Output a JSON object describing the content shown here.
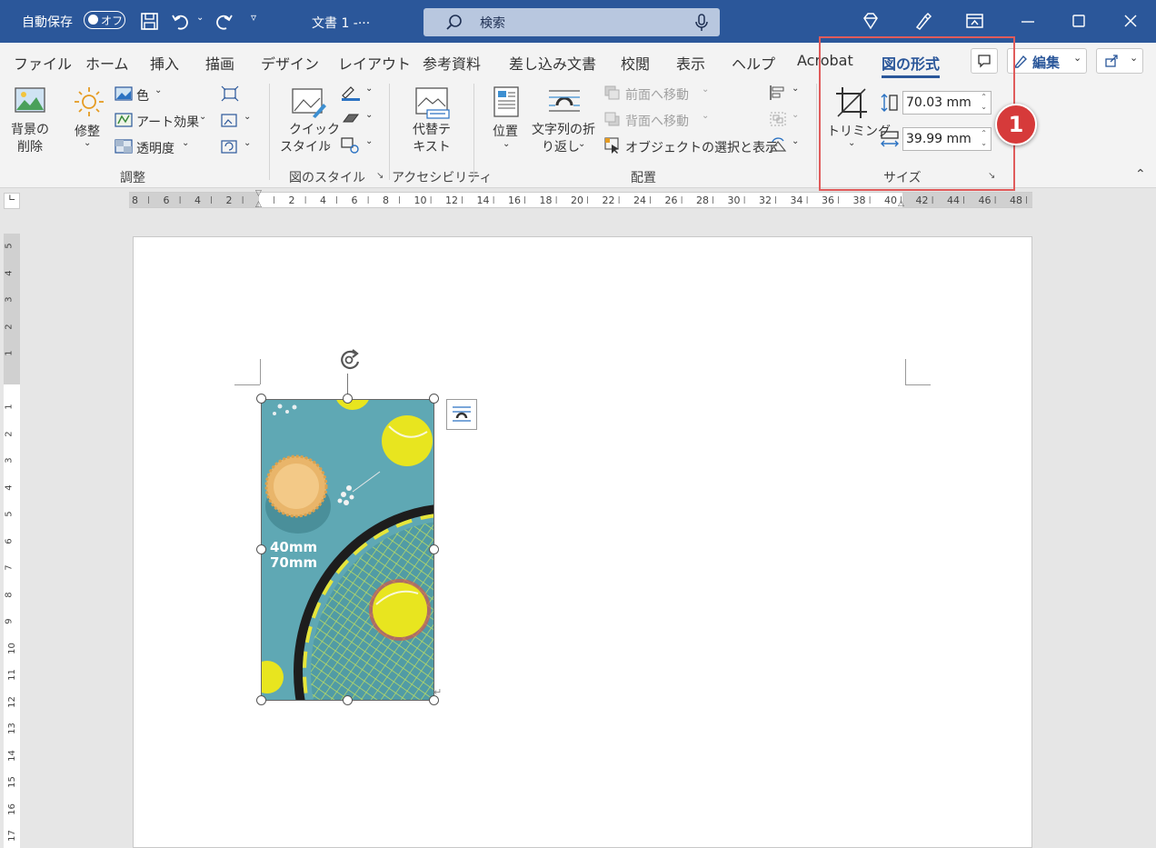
{
  "titlebar": {
    "autosave_label": "自動保存",
    "autosave_state": "オフ",
    "doc_title": "文書 1  -···",
    "search_placeholder": "検索"
  },
  "tabs": [
    {
      "label": "ファイル"
    },
    {
      "label": "ホーム"
    },
    {
      "label": "挿入"
    },
    {
      "label": "描画"
    },
    {
      "label": "デザイン"
    },
    {
      "label": "レイアウト"
    },
    {
      "label": "参考資料"
    },
    {
      "label": "差し込み文書"
    },
    {
      "label": "校閲"
    },
    {
      "label": "表示"
    },
    {
      "label": "ヘルプ"
    },
    {
      "label": "Acrobat"
    },
    {
      "label": "図の形式",
      "active": true
    }
  ],
  "edit_button": "編集",
  "ribbon": {
    "adjust": {
      "remove_bg": [
        "背景の",
        "削除"
      ],
      "corrections": "修整",
      "color": "色",
      "art_effects": "アート効果",
      "transparency": "透明度",
      "group_label": "調整"
    },
    "styles": {
      "quick_styles": [
        "クイック",
        "スタイル"
      ],
      "group_label": "図のスタイル"
    },
    "accessibility": {
      "alt_text": [
        "代替テ",
        "キスト"
      ],
      "group_label": "アクセシビリティ"
    },
    "arrange": {
      "position": "位置",
      "wrap_text": [
        "文字列の折",
        "り返し"
      ],
      "bring_forward": "前面へ移動",
      "send_backward": "背面へ移動",
      "selection_pane": "オブジェクトの選択と表示",
      "group_label": "配置"
    },
    "size": {
      "crop": "トリミング",
      "height": "70.03 mm",
      "width": "39.99 mm",
      "group_label": "サイズ"
    }
  },
  "callout_number": "1",
  "ruler": {
    "horizontal": [
      "8",
      "6",
      "4",
      "2",
      "",
      "2",
      "4",
      "6",
      "8",
      "10",
      "12",
      "14",
      "16",
      "18",
      "20",
      "22",
      "24",
      "26",
      "28",
      "30",
      "32",
      "34",
      "36",
      "38",
      "40",
      "42",
      "44",
      "46",
      "48"
    ],
    "vertical": [
      "5",
      "4",
      "3",
      "2",
      "1",
      "",
      "1",
      "2",
      "3",
      "4",
      "5",
      "6",
      "7",
      "8",
      "9",
      "10",
      "11",
      "12",
      "13",
      "14",
      "15",
      "16",
      "17"
    ]
  },
  "image_overlay": {
    "line1": "40mm",
    "line2": "70mm"
  },
  "colors": {
    "titlebar": "#2b579a",
    "highlight": "#e05b5b",
    "callout": "#d63a3a",
    "image_bg": "#5fa8b4",
    "tennis_ball": "#e8e51f"
  }
}
